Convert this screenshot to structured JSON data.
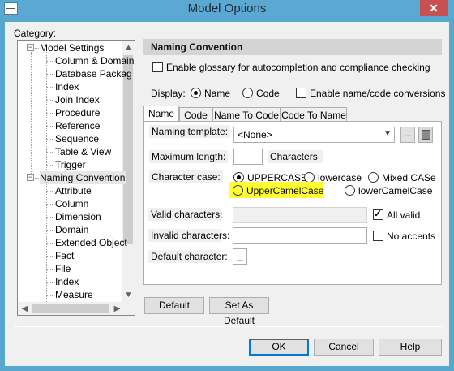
{
  "window": {
    "title": "Model Options",
    "close_label": "✕"
  },
  "category": {
    "label": "Category:",
    "tree": [
      {
        "label": "Model Settings",
        "level": 0,
        "toggle": "−"
      },
      {
        "label": "Column & Domain",
        "level": 1
      },
      {
        "label": "Database Packag",
        "level": 1
      },
      {
        "label": "Index",
        "level": 1
      },
      {
        "label": "Join Index",
        "level": 1
      },
      {
        "label": "Procedure",
        "level": 1
      },
      {
        "label": "Reference",
        "level": 1
      },
      {
        "label": "Sequence",
        "level": 1
      },
      {
        "label": "Table & View",
        "level": 1
      },
      {
        "label": "Trigger",
        "level": 1
      },
      {
        "label": "Naming Convention",
        "level": 0,
        "toggle": "−",
        "selected": true
      },
      {
        "label": "Attribute",
        "level": 1
      },
      {
        "label": "Column",
        "level": 1
      },
      {
        "label": "Dimension",
        "level": 1
      },
      {
        "label": "Domain",
        "level": 1
      },
      {
        "label": "Extended Object",
        "level": 1
      },
      {
        "label": "Fact",
        "level": 1
      },
      {
        "label": "File",
        "level": 1
      },
      {
        "label": "Index",
        "level": 1
      },
      {
        "label": "Measure",
        "level": 1
      }
    ]
  },
  "section": {
    "title": "Naming Convention"
  },
  "glossary": {
    "label": "Enable glossary for autocompletion and compliance checking",
    "checked": false
  },
  "display": {
    "label": "Display:",
    "name_label": "Name",
    "code_label": "Code",
    "selected": "Name",
    "conversion_label": "Enable name/code conversions",
    "conversion_checked": false
  },
  "tabs": [
    "Name",
    "Code",
    "Name To Code",
    "Code To Name"
  ],
  "active_tab": "Name",
  "form": {
    "naming_template_label": "Naming template:",
    "naming_template_value": "<None>",
    "template_button": "...",
    "max_length_label": "Maximum length:",
    "max_length_value": "",
    "characters_label": "Characters",
    "case_label": "Character case:",
    "case_options": [
      "UPPERCASE",
      "lowercase",
      "Mixed CASe",
      "UpperCamelCase",
      "lowerCamelCase"
    ],
    "case_selected": "UPPERCASE",
    "valid_label": "Valid characters:",
    "valid_value": "",
    "all_valid_label": "All valid",
    "all_valid_checked": true,
    "invalid_label": "Invalid characters:",
    "invalid_value": "",
    "no_accents_label": "No accents",
    "no_accents_checked": false,
    "default_char_label": "Default character:",
    "default_char_value": "_"
  },
  "buttons": {
    "default": "Default",
    "set_as_default": "Set As Default",
    "ok": "OK",
    "cancel": "Cancel",
    "help": "Help"
  },
  "colors": {
    "titlebar": "#5ba8d3",
    "close": "#c75050",
    "highlight": "#ffff33",
    "ok_border": "#0078d7"
  }
}
